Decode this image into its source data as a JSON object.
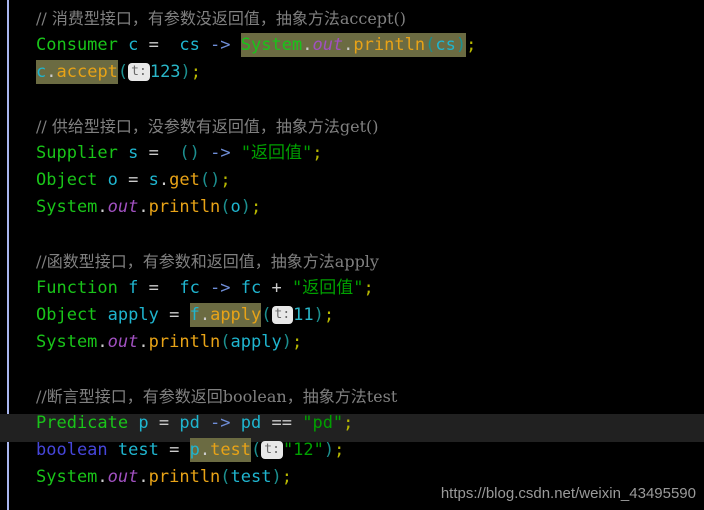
{
  "editor": {
    "background_color": "#000000",
    "guide_line_color": "#a9b7f0",
    "current_line_color": "#212121",
    "highlight_color": "#6b6b42",
    "hint_badge_color": "#e8e8e8"
  },
  "watermark": {
    "text": "https://blog.csdn.net/weixin_43495590"
  },
  "blocks": [
    {
      "comment": "// 消费型接口，有参数没返回值，抽象方法accept()",
      "lines": [
        {
          "type": "consumer-declaration",
          "tokens": [
            {
              "text": "Consumer",
              "cls": "c-type"
            },
            {
              "text": " c ",
              "cls": "c-var"
            },
            {
              "text": "=",
              "cls": "c-op"
            },
            {
              "text": "  cs ",
              "cls": "c-var"
            },
            {
              "text": "->",
              "cls": "c-arrow"
            },
            {
              "text": " ",
              "cls": "c-plain"
            },
            {
              "text": "System",
              "cls": "c-type hl"
            },
            {
              "text": ".",
              "cls": "c-plain hl"
            },
            {
              "text": "out",
              "cls": "c-static hl"
            },
            {
              "text": ".",
              "cls": "c-plain hl"
            },
            {
              "text": "println",
              "cls": "c-method hl"
            },
            {
              "text": "(",
              "cls": "c-paren hl"
            },
            {
              "text": "cs",
              "cls": "c-var hl"
            },
            {
              "text": ")",
              "cls": "c-paren hl"
            },
            {
              "text": ";",
              "cls": "c-semi"
            }
          ]
        },
        {
          "type": "consumer-call",
          "tokens": [
            {
              "text": "c",
              "cls": "c-var hl"
            },
            {
              "text": ".",
              "cls": "c-plain hl"
            },
            {
              "text": "accept",
              "cls": "c-method hl"
            },
            {
              "text": "(",
              "cls": "c-paren"
            },
            {
              "text": "t:",
              "cls": "hint"
            },
            {
              "text": "123",
              "cls": "c-number"
            },
            {
              "text": ")",
              "cls": "c-paren"
            },
            {
              "text": ";",
              "cls": "c-semi"
            }
          ]
        }
      ]
    },
    {
      "comment": "// 供给型接口，没参数有返回值，抽象方法get()",
      "lines": [
        {
          "type": "supplier-declaration",
          "tokens": [
            {
              "text": "Supplier",
              "cls": "c-type"
            },
            {
              "text": " s ",
              "cls": "c-var"
            },
            {
              "text": "=",
              "cls": "c-op"
            },
            {
              "text": "  ",
              "cls": "c-plain"
            },
            {
              "text": "()",
              "cls": "c-paren"
            },
            {
              "text": " ",
              "cls": "c-plain"
            },
            {
              "text": "->",
              "cls": "c-arrow"
            },
            {
              "text": " ",
              "cls": "c-plain"
            },
            {
              "text": "\"返回值\"",
              "cls": "c-string"
            },
            {
              "text": ";",
              "cls": "c-semi"
            }
          ]
        },
        {
          "type": "supplier-get",
          "tokens": [
            {
              "text": "Object",
              "cls": "c-type"
            },
            {
              "text": " o ",
              "cls": "c-var"
            },
            {
              "text": "=",
              "cls": "c-op"
            },
            {
              "text": " s",
              "cls": "c-var"
            },
            {
              "text": ".",
              "cls": "c-plain"
            },
            {
              "text": "get",
              "cls": "c-method"
            },
            {
              "text": "()",
              "cls": "c-paren"
            },
            {
              "text": ";",
              "cls": "c-semi"
            }
          ]
        },
        {
          "type": "supplier-print",
          "tokens": [
            {
              "text": "System",
              "cls": "c-type"
            },
            {
              "text": ".",
              "cls": "c-plain"
            },
            {
              "text": "out",
              "cls": "c-static"
            },
            {
              "text": ".",
              "cls": "c-plain"
            },
            {
              "text": "println",
              "cls": "c-method"
            },
            {
              "text": "(",
              "cls": "c-paren"
            },
            {
              "text": "o",
              "cls": "c-var"
            },
            {
              "text": ")",
              "cls": "c-paren"
            },
            {
              "text": ";",
              "cls": "c-semi"
            }
          ]
        }
      ]
    },
    {
      "comment": "//函数型接口，有参数和返回值，抽象方法apply",
      "lines": [
        {
          "type": "function-declaration",
          "tokens": [
            {
              "text": "Function",
              "cls": "c-type"
            },
            {
              "text": " f ",
              "cls": "c-var"
            },
            {
              "text": "=",
              "cls": "c-op"
            },
            {
              "text": "  fc ",
              "cls": "c-var"
            },
            {
              "text": "->",
              "cls": "c-arrow"
            },
            {
              "text": " fc ",
              "cls": "c-var"
            },
            {
              "text": "+",
              "cls": "c-op"
            },
            {
              "text": " ",
              "cls": "c-plain"
            },
            {
              "text": "\"返回值\"",
              "cls": "c-string"
            },
            {
              "text": ";",
              "cls": "c-semi"
            }
          ]
        },
        {
          "type": "function-apply",
          "tokens": [
            {
              "text": "Object",
              "cls": "c-type"
            },
            {
              "text": " apply ",
              "cls": "c-var"
            },
            {
              "text": "=",
              "cls": "c-op"
            },
            {
              "text": " ",
              "cls": "c-plain"
            },
            {
              "text": "f",
              "cls": "c-var hl"
            },
            {
              "text": ".",
              "cls": "c-plain hl"
            },
            {
              "text": "apply",
              "cls": "c-method hl"
            },
            {
              "text": "(",
              "cls": "c-paren"
            },
            {
              "text": "t:",
              "cls": "hint"
            },
            {
              "text": "11",
              "cls": "c-number"
            },
            {
              "text": ")",
              "cls": "c-paren"
            },
            {
              "text": ";",
              "cls": "c-semi"
            }
          ]
        },
        {
          "type": "function-print",
          "tokens": [
            {
              "text": "System",
              "cls": "c-type"
            },
            {
              "text": ".",
              "cls": "c-plain"
            },
            {
              "text": "out",
              "cls": "c-static"
            },
            {
              "text": ".",
              "cls": "c-plain"
            },
            {
              "text": "println",
              "cls": "c-method"
            },
            {
              "text": "(",
              "cls": "c-paren"
            },
            {
              "text": "apply",
              "cls": "c-var"
            },
            {
              "text": ")",
              "cls": "c-paren"
            },
            {
              "text": ";",
              "cls": "c-semi"
            }
          ]
        }
      ]
    },
    {
      "comment": "//断言型接口，有参数返回boolean，抽象方法test",
      "lines": [
        {
          "type": "predicate-declaration",
          "current": true,
          "tokens": [
            {
              "text": "Predicate",
              "cls": "c-type"
            },
            {
              "text": " p ",
              "cls": "c-var"
            },
            {
              "text": "=",
              "cls": "c-op"
            },
            {
              "text": " pd ",
              "cls": "c-var"
            },
            {
              "text": "->",
              "cls": "c-arrow"
            },
            {
              "text": " pd ",
              "cls": "c-var"
            },
            {
              "text": "==",
              "cls": "c-op"
            },
            {
              "text": " ",
              "cls": "c-plain"
            },
            {
              "text": "\"pd\"",
              "cls": "c-string"
            },
            {
              "text": ";",
              "cls": "c-semi"
            }
          ]
        },
        {
          "type": "predicate-test",
          "tokens": [
            {
              "text": "boolean",
              "cls": "c-keyword"
            },
            {
              "text": " test ",
              "cls": "c-var"
            },
            {
              "text": "=",
              "cls": "c-op"
            },
            {
              "text": " ",
              "cls": "c-plain"
            },
            {
              "text": "p",
              "cls": "c-var hl"
            },
            {
              "text": ".",
              "cls": "c-plain hl"
            },
            {
              "text": "test",
              "cls": "c-method hl"
            },
            {
              "text": "(",
              "cls": "c-paren"
            },
            {
              "text": "t:",
              "cls": "hint"
            },
            {
              "text": "\"12\"",
              "cls": "c-string"
            },
            {
              "text": ")",
              "cls": "c-paren"
            },
            {
              "text": ";",
              "cls": "c-semi"
            }
          ]
        },
        {
          "type": "predicate-print",
          "tokens": [
            {
              "text": "System",
              "cls": "c-type"
            },
            {
              "text": ".",
              "cls": "c-plain"
            },
            {
              "text": "out",
              "cls": "c-static"
            },
            {
              "text": ".",
              "cls": "c-plain"
            },
            {
              "text": "println",
              "cls": "c-method"
            },
            {
              "text": "(",
              "cls": "c-paren"
            },
            {
              "text": "test",
              "cls": "c-var"
            },
            {
              "text": ")",
              "cls": "c-paren"
            },
            {
              "text": ";",
              "cls": "c-semi"
            }
          ]
        }
      ]
    }
  ]
}
